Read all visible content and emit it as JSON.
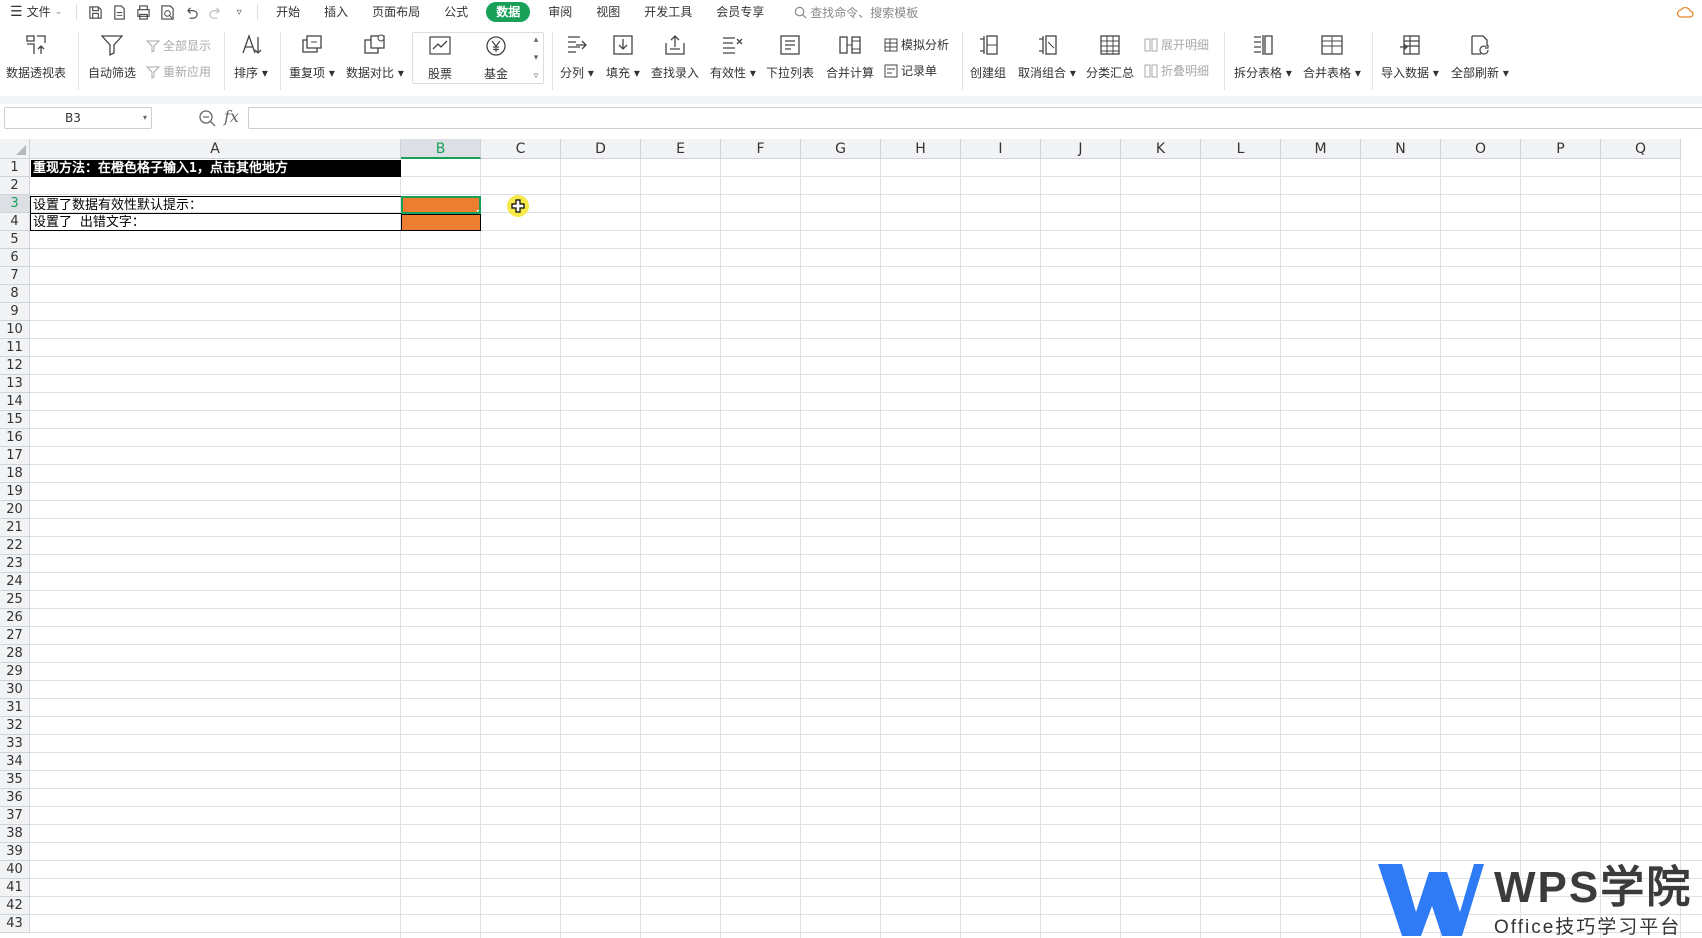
{
  "menubar": {
    "file": "文件",
    "tabs": [
      "开始",
      "插入",
      "页面布局",
      "公式",
      "数据",
      "审阅",
      "视图",
      "开发工具",
      "会员专享"
    ],
    "active_tab": "数据",
    "search_placeholder": "查找命令、搜索模板"
  },
  "ribbon": {
    "pivot": "数据透视表",
    "autofilter": "自动筛选",
    "show_all": "全部显示",
    "reapply": "重新应用",
    "sort": "排序",
    "duplicates": "重复项",
    "compare": "数据对比",
    "stock": "股票",
    "fund": "基金",
    "split_col": "分列",
    "fill": "填充",
    "lookup_entry": "查找录入",
    "validity": "有效性",
    "dropdown_list": "下拉列表",
    "consolidate": "合并计算",
    "simulation": "模拟分析",
    "record_form": "记录单",
    "create_group": "创建组",
    "ungroup": "取消组合",
    "subtotal": "分类汇总",
    "expand_detail": "展开明细",
    "collapse_detail": "折叠明细",
    "split_table": "拆分表格",
    "merge_table": "合并表格",
    "import_data": "导入数据",
    "refresh_all": "全部刷新"
  },
  "formula_bar": {
    "name_box": "B3",
    "fx": "fx",
    "formula": ""
  },
  "sheet": {
    "columns": [
      "A",
      "B",
      "C",
      "D",
      "E",
      "F",
      "G",
      "H",
      "I",
      "J",
      "K",
      "L",
      "M",
      "N",
      "O",
      "P",
      "Q"
    ],
    "selected_column": "B",
    "selected_row": "3",
    "row_count": 43,
    "cells": {
      "A1": "重现方法：在橙色格子输入1，点击其他地方",
      "A3": "设置了数据有效性默认提示：",
      "A4": "设置了 出错文字："
    }
  },
  "watermark": {
    "brand": "WPS学院",
    "subtitle": "Office技巧学习平台"
  },
  "colors": {
    "accent": "#18a058",
    "orange_cell": "#ed7d31"
  }
}
